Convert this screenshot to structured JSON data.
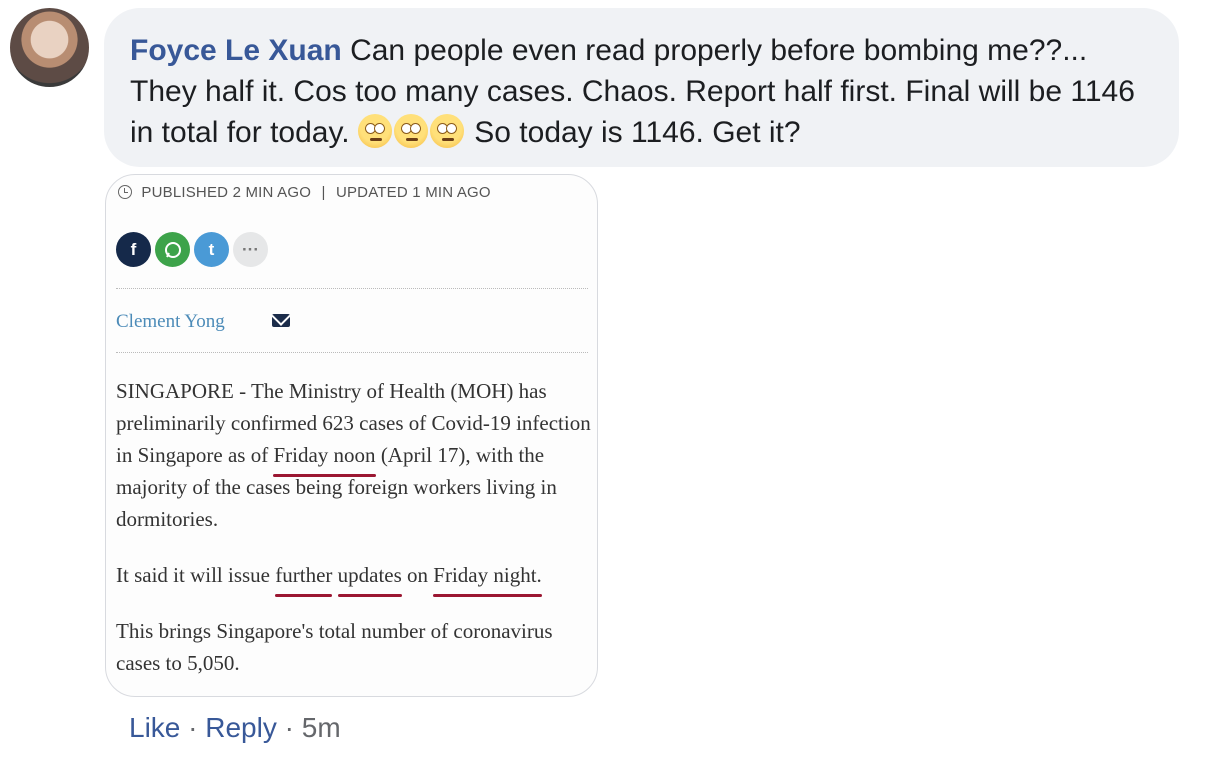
{
  "comment": {
    "author": "Foyce Le Xuan",
    "text_before_emoji": "Can people even read properly before bombing me??... They half it. Cos too many cases. Chaos. Report half first. Final will be 1146 in total for today.",
    "emoji_name": "face-with-rolling-eyes-emoji",
    "text_after_emoji": "So today is 1146. Get it?"
  },
  "attachment": {
    "published_label": "PUBLISHED",
    "published_time": "2 MIN AGO",
    "separator": "|",
    "updated_label": "UPDATED",
    "updated_time": "1 MIN AGO",
    "social": {
      "facebook": "f",
      "twitter": "t",
      "more": "···"
    },
    "author": "Clement Yong",
    "p1_before": "SINGAPORE - The Ministry of Health (MOH) has preliminarily confirmed 623 cases of Covid-19 infection in Singapore as of",
    "p1_mark": "Friday noon",
    "p1_after": "(April 17), with the majority of the cases being foreign workers living in dormitories.",
    "p2_before": "It said it will issue",
    "p2_mark1": "further",
    "p2_mark2": "updates",
    "p2_mid": "on",
    "p2_mark3": "Friday night.",
    "p3": "This brings Singapore's total number of coronavirus cases to 5,050.",
    "underline_color": "#9b1732"
  },
  "actions": {
    "like": "Like",
    "dot": "·",
    "reply": "Reply",
    "time": "5m"
  },
  "colors": {
    "bubble_bg": "#f0f2f5",
    "author_link": "#385898",
    "meta_gray": "#65676b"
  }
}
